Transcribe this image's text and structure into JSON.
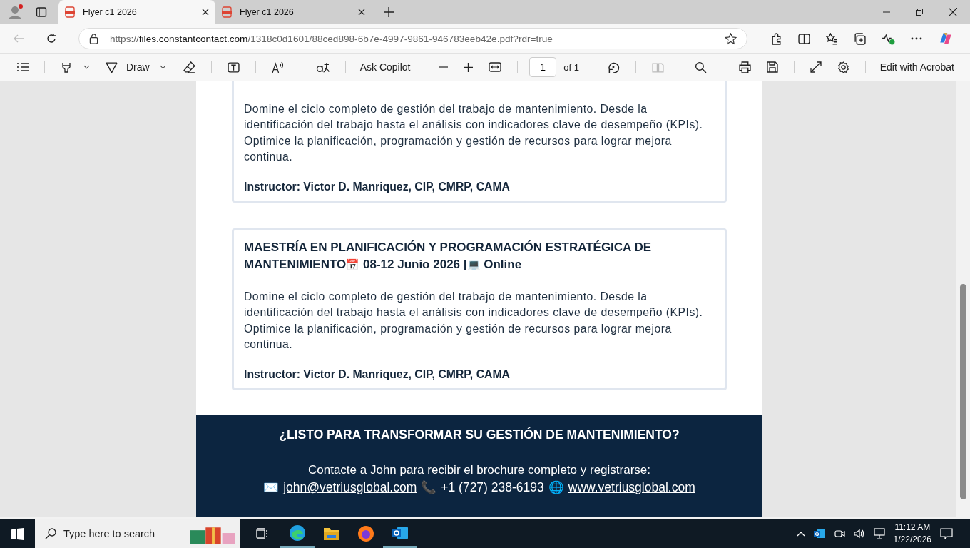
{
  "tabs": [
    {
      "title": "Flyer c1 2026",
      "selected": true
    },
    {
      "title": "Flyer c1 2026",
      "selected": false
    }
  ],
  "address_bar": {
    "scheme": "https://",
    "host": "files.constantcontact.com",
    "path": "/1318c0d1601/88ced898-6b7e-4997-9861-946783eeb42e.pdf?rdr=true"
  },
  "pdf_toolbar": {
    "draw_label": "Draw",
    "ask_label": "Ask Copilot",
    "page": "1",
    "page_total": "of 1",
    "edit_label": "Edit with Acrobat"
  },
  "cards": [
    {
      "description": "Domine el ciclo completo de gestión del trabajo de mantenimiento. Desde la identificación del trabajo hasta el análisis con indicadores clave de desempeño (KPIs). Optimice la planificación, programación y gestión de recursos para lograr mejora continua.",
      "instructor": "Instructor: Victor D. Manriquez, CIP, CMRP, CAMA"
    },
    {
      "title": "MAESTRÍA EN PLANIFICACIÓN Y PROGRAMACIÓN ESTRATÉGICA DE MANTENIMIENTO",
      "emoji_date": "📅",
      "date": "08-12 Junio 2026 |",
      "emoji_mode": "💻",
      "mode": "Online",
      "description": "Domine el ciclo completo de gestión del trabajo de mantenimiento. Desde la identificación del trabajo hasta el análisis con indicadores clave de desempeño (KPIs). Optimice la planificación, programación y gestión de recursos para lograr mejora continua.",
      "instructor": "Instructor: Victor D. Manriquez, CIP, CMRP, CAMA"
    }
  ],
  "footer": {
    "heading": "¿LISTO PARA TRANSFORMAR SU GESTIÓN DE MANTENIMIENTO?",
    "contact_text": "Contacte a John para recibir el brochure completo y registrarse:",
    "email_emoji": "✉️",
    "email": "john@vetriusglobal.com",
    "phone_emoji": "📞",
    "phone": "+1 (727) 238-6193",
    "web_emoji": "🌐",
    "website": "www.vetriusglobal.com"
  },
  "taskbar": {
    "search_placeholder": "Type here to search",
    "time": "11:12 AM",
    "date": "1/22/2026"
  }
}
